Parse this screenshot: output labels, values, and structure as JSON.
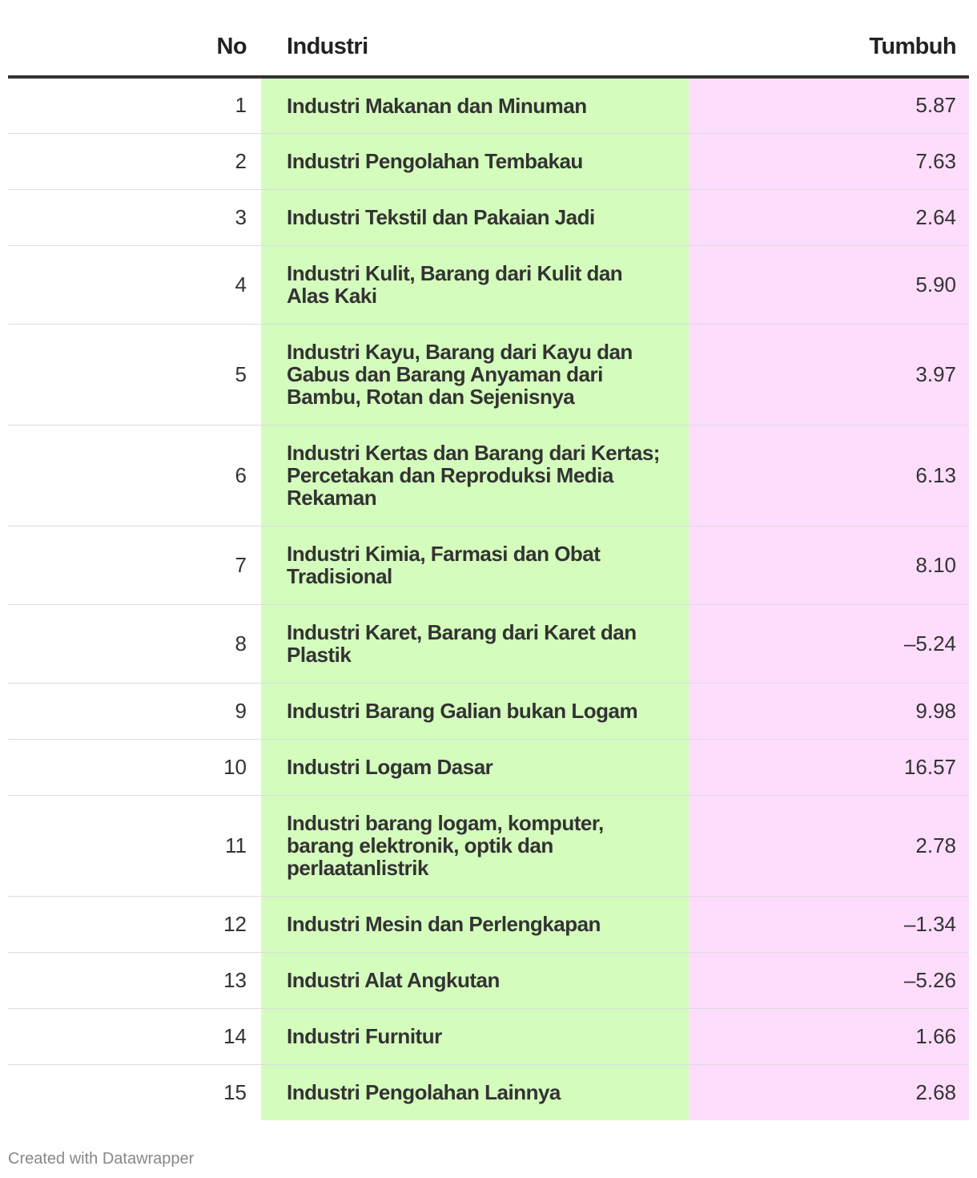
{
  "chart_data": {
    "type": "table",
    "columns": [
      "No",
      "Industri",
      "Tumbuh"
    ],
    "column_colors": {
      "Industri": "#d4fcbd",
      "Tumbuh": "#fddcfc"
    },
    "rows": [
      {
        "no": "1",
        "industri": "Industri Makanan dan Minuman",
        "tumbuh": "5.87"
      },
      {
        "no": "2",
        "industri": "Industri Pengolahan Tembakau",
        "tumbuh": "7.63"
      },
      {
        "no": "3",
        "industri": "Industri Tekstil dan Pakaian Jadi",
        "tumbuh": "2.64"
      },
      {
        "no": "4",
        "industri": "Industri Kulit, Barang dari Kulit dan Alas Kaki",
        "tumbuh": "5.90"
      },
      {
        "no": "5",
        "industri": "Industri Kayu, Barang dari Kayu dan Gabus dan Barang Anyaman dari Bambu, Rotan dan Sejenisnya",
        "tumbuh": "3.97"
      },
      {
        "no": "6",
        "industri": "Industri Kertas dan Barang dari Kertas; Percetakan dan Reproduksi Media Rekaman",
        "tumbuh": "6.13"
      },
      {
        "no": "7",
        "industri": "Industri Kimia, Farmasi dan Obat Tradisional",
        "tumbuh": "8.10"
      },
      {
        "no": "8",
        "industri": "Industri Karet, Barang dari Karet dan Plastik",
        "tumbuh": "–5.24"
      },
      {
        "no": "9",
        "industri": "Industri Barang Galian bukan Logam",
        "tumbuh": "9.98"
      },
      {
        "no": "10",
        "industri": "Industri Logam Dasar",
        "tumbuh": "16.57"
      },
      {
        "no": "11",
        "industri": "Industri barang logam, komputer, barang elektronik, optik dan perlaatanlistrik",
        "tumbuh": "2.78"
      },
      {
        "no": "12",
        "industri": "Industri Mesin dan Perlengkapan",
        "tumbuh": "–1.34"
      },
      {
        "no": "13",
        "industri": "Industri Alat Angkutan",
        "tumbuh": "–5.26"
      },
      {
        "no": "14",
        "industri": "Industri Furnitur",
        "tumbuh": "1.66"
      },
      {
        "no": "15",
        "industri": "Industri Pengolahan Lainnya",
        "tumbuh": "2.68"
      }
    ]
  },
  "footer": "Created with Datawrapper"
}
